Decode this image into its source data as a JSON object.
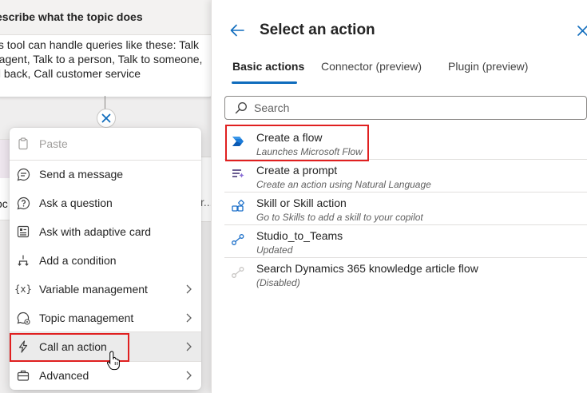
{
  "topic_card": {
    "header": "escribe what the topic does",
    "body_lines": [
      "his tool can handle queries like these: Talk",
      "o agent, Talk to a person, Talk to someone,",
      "all back, Call customer service"
    ]
  },
  "background_nodes": {
    "left_text": "oc",
    "right_text": "r..."
  },
  "context_menu": {
    "items": [
      {
        "label": "Paste",
        "icon": "paste-icon",
        "disabled": true
      },
      {
        "label": "Send a message",
        "icon": "chat-bubble-icon"
      },
      {
        "label": "Ask a question",
        "icon": "question-bubble-icon"
      },
      {
        "label": "Ask with adaptive card",
        "icon": "adaptive-card-icon"
      },
      {
        "label": "Add a condition",
        "icon": "branch-icon"
      },
      {
        "label": "Variable management",
        "icon": "variable-icon",
        "submenu": true
      },
      {
        "label": "Topic management",
        "icon": "topic-icon",
        "submenu": true
      },
      {
        "label": "Call an action",
        "icon": "lightning-icon",
        "submenu": true,
        "active": true
      },
      {
        "label": "Advanced",
        "icon": "toolbox-icon",
        "submenu": true
      }
    ]
  },
  "panel": {
    "title": "Select an action",
    "tabs": [
      {
        "label": "Basic actions",
        "active": true
      },
      {
        "label": "Connector (preview)"
      },
      {
        "label": "Plugin (preview)"
      }
    ],
    "search_placeholder": "Search",
    "actions": [
      {
        "name": "Create a flow",
        "description": "Launches Microsoft Flow",
        "icon": "power-automate-icon"
      },
      {
        "name": "Create a prompt",
        "description": "Create an action using Natural Language",
        "icon": "prompt-icon"
      },
      {
        "name": "Skill or Skill action",
        "description": "Go to Skills to add a skill to your copilot",
        "icon": "skill-icon"
      },
      {
        "name": "Studio_to_Teams",
        "description": "Updated",
        "icon": "flow-icon"
      },
      {
        "name": "Search Dynamics 365 knowledge article flow",
        "description": "(Disabled)",
        "icon": "flow-disabled-icon"
      }
    ]
  },
  "colors": {
    "accent": "#0f6cbd",
    "highlight": "#e02020"
  }
}
